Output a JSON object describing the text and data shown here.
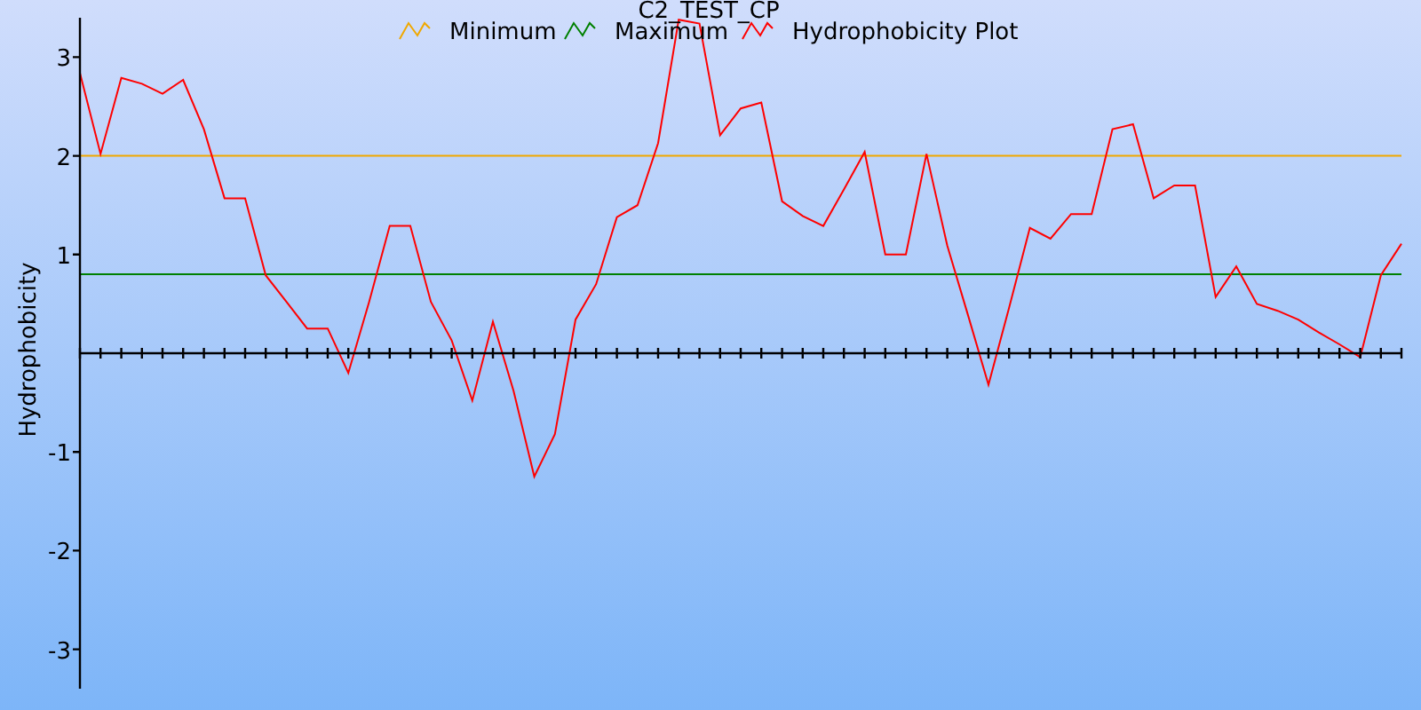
{
  "chart": {
    "chart_data": {
      "type": "line",
      "title": "C2_TEST_CP",
      "legend": "top",
      "ylabel": "Hydrophobicity",
      "categories": [
        null,
        null,
        null,
        null,
        null,
        null,
        null,
        null,
        null,
        null,
        null,
        null,
        null,
        null,
        null,
        null,
        null,
        null,
        null,
        null,
        null,
        null,
        null,
        null,
        null,
        null,
        null,
        null,
        null,
        null,
        null,
        null,
        null,
        null,
        null,
        null,
        null,
        null,
        null,
        null,
        null,
        null,
        null,
        null,
        null,
        null,
        null,
        null,
        null,
        null,
        null,
        null,
        null,
        null,
        null,
        null,
        null,
        null,
        null,
        null,
        null,
        null,
        null,
        null,
        null
      ],
      "ylim": [
        -3.4,
        3.4
      ],
      "yticks": [
        -3,
        -2,
        -1,
        1,
        2,
        3
      ],
      "series": [
        {
          "name": "Minimum",
          "color": "#f0a800",
          "values": [
            2,
            2,
            2,
            2,
            2,
            2,
            2,
            2,
            2,
            2,
            2,
            2,
            2,
            2,
            2,
            2,
            2,
            2,
            2,
            2,
            2,
            2,
            2,
            2,
            2,
            2,
            2,
            2,
            2,
            2,
            2,
            2,
            2,
            2,
            2,
            2,
            2,
            2,
            2,
            2,
            2,
            2,
            2,
            2,
            2,
            2,
            2,
            2,
            2,
            2,
            2,
            2,
            2,
            2,
            2,
            2,
            2,
            2,
            2,
            2,
            2,
            2,
            2,
            2,
            2
          ]
        },
        {
          "name": "Maximum",
          "color": "#008000",
          "values": [
            0.8,
            0.8,
            0.8,
            0.8,
            0.8,
            0.8,
            0.8,
            0.8,
            0.8,
            0.8,
            0.8,
            0.8,
            0.8,
            0.8,
            0.8,
            0.8,
            0.8,
            0.8,
            0.8,
            0.8,
            0.8,
            0.8,
            0.8,
            0.8,
            0.8,
            0.8,
            0.8,
            0.8,
            0.8,
            0.8,
            0.8,
            0.8,
            0.8,
            0.8,
            0.8,
            0.8,
            0.8,
            0.8,
            0.8,
            0.8,
            0.8,
            0.8,
            0.8,
            0.8,
            0.8,
            0.8,
            0.8,
            0.8,
            0.8,
            0.8,
            0.8,
            0.8,
            0.8,
            0.8,
            0.8,
            0.8,
            0.8,
            0.8,
            0.8,
            0.8,
            0.8,
            0.8,
            0.8,
            0.8,
            0.8
          ]
        },
        {
          "name": "Hydrophobicity Plot",
          "color": "#ff0000",
          "values": [
            2.84,
            2.02,
            2.79,
            2.73,
            2.63,
            2.77,
            2.27,
            1.57,
            1.57,
            0.79,
            0.52,
            0.25,
            0.25,
            -0.2,
            0.52,
            1.29,
            1.29,
            0.52,
            0.13,
            -0.48,
            0.32,
            -0.38,
            -1.25,
            -0.82,
            0.34,
            0.7,
            1.38,
            1.5,
            2.13,
            3.38,
            3.34,
            2.21,
            2.48,
            2.54,
            1.54,
            1.39,
            1.29,
            1.66,
            2.04,
            1.0,
            1.0,
            2.02,
            1.09,
            0.39,
            -0.32,
            0.46,
            1.27,
            1.16,
            1.41,
            1.41,
            2.27,
            2.32,
            1.57,
            1.7,
            1.7,
            0.57,
            0.88,
            0.5,
            0.43,
            0.34,
            0.21,
            0.09,
            -0.04,
            0.79,
            1.11
          ]
        }
      ]
    }
  }
}
